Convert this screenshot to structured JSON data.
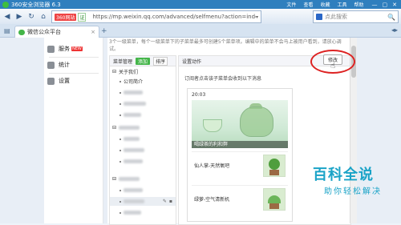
{
  "browser": {
    "title": "360安全浏览器 6.3",
    "menus": [
      "文件",
      "查看",
      "收藏",
      "工具",
      "帮助"
    ],
    "window_controls": [
      "—",
      "▢",
      "✕"
    ],
    "nav": {
      "back": "◀",
      "forward": "▶",
      "refresh": "↻",
      "home": "⌂",
      "star": "★"
    },
    "address": {
      "badge": "360网站",
      "secure": "证",
      "url": "https://mp.weixin.qq.com/advanced/selfmenu?action=index&t=",
      "dropdown": "▾"
    },
    "search": {
      "placeholder": "点此搜索",
      "icon": "🔍"
    },
    "tab": {
      "title": "微信公众平台",
      "close": "×"
    },
    "new_tab": "+",
    "tab_right": "◂▸"
  },
  "sidebar": {
    "items": [
      {
        "label": "服务",
        "badge": "NEW"
      },
      {
        "label": "统计",
        "badge": ""
      },
      {
        "label": "设置",
        "badge": ""
      }
    ]
  },
  "content": {
    "hint": "3个一级菜单，每个一级菜单下的子菜单最多可创建5个菜单项。编辑中的菜单不会马上被用户看到，请放心调试。",
    "menu_panel": {
      "header": "菜单管理",
      "add": "添加",
      "sort": "排序",
      "items": [
        {
          "label": "关于我们",
          "level": 1
        },
        {
          "label": "公司简介",
          "level": 2
        }
      ]
    },
    "action_panel": {
      "header": "设置动作",
      "edit_button": "修改",
      "subtitle": "订阅者点击该子菜单会收到以下消息"
    },
    "card": {
      "date": "20:03",
      "hero_caption": "喝绿茶的利和弊",
      "rows": [
        {
          "title": "仙人掌-天然氧吧"
        },
        {
          "title": "绿萝-空气清新机"
        }
      ]
    }
  },
  "watermark": {
    "big": "百科全说",
    "small": "助你轻松解决"
  },
  "colors": {
    "titlebar": "#2f7fbe",
    "accent_green": "#44b549",
    "highlight_red": "#d22",
    "watermark": "#1aa3c7"
  }
}
